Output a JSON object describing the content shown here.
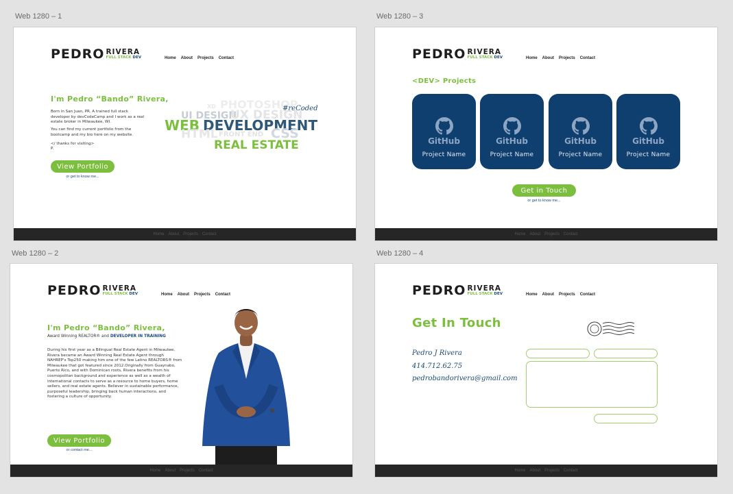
{
  "frames": {
    "f1": "Web 1280 – 1",
    "f2": "Web 1280 – 2",
    "f3": "Web 1280 – 3",
    "f4": "Web 1280 – 4"
  },
  "logo": {
    "main": "PEDRO",
    "side": "RIVERA",
    "tag_a": "FULL STACK",
    "tag_b": "DEV"
  },
  "nav": [
    "Home",
    "About",
    "Projects",
    "Contact"
  ],
  "footer": [
    "Home",
    "About",
    "Projects",
    "Contact"
  ],
  "home": {
    "heading": "I'm Pedro “Bando” Rivera,",
    "p1": "Born in San Juan, PR. A trained full stack developer by devCodeCamp and I work as a real estate broker in Milwaukee, WI.",
    "p2": "You can find my current portfolio from the bootcamp and my bio here on my website.",
    "p3": "</ thanks for visiting>",
    "p4": "P.",
    "button": "View Portfolio",
    "link": "or get to know me...",
    "cloud": {
      "xd": "XD",
      "photoshop": "PHOTOSHOP",
      "uidesign": "UI DESIGN",
      "uxdesign": "UX DESIGN",
      "recoded": "#reCoded",
      "web": "WEB",
      "development": "DEVELOPMENT",
      "html": "HTML",
      "frontend": "FRONT END",
      "css": "CSS",
      "realestate": "REAL ESTATE"
    }
  },
  "about": {
    "heading": "I'm Pedro “Bando” Rivera,",
    "sub_a": "Award Winning REALTOR® and ",
    "sub_b": "DEVELOPER IN TRAINING",
    "body": "During his first year as a Bilingual Real Estate Agent in Milwaukee, Rivera became an Award Winning Real Estate Agent through NAHREP's Top250 making him one of the few Latino REALTORS® from Milwaukee that got featured since 2012.Originally from Guaynabo, Puerto Rico, and with Dominican roots, Rivera benefits from his cosmopolitan background and experience as well as a wealth of international contacts to serve as a resource to home buyers, home sellers, and real estate agents. Believer in sustainable performance, purposeful leadership, bringing back human interactions, and fostering a culture of opportunity.",
    "button": "View Portfolio",
    "link": "or contact me..."
  },
  "projects": {
    "heading": "<DEV> Projects",
    "cards": [
      {
        "brand": "GitHub",
        "name": "Project Name"
      },
      {
        "brand": "GitHub",
        "name": "Project Name"
      },
      {
        "brand": "GitHub",
        "name": "Project Name"
      },
      {
        "brand": "GitHub",
        "name": "Project Name"
      }
    ],
    "button": "Get in Touch",
    "link": "or get to know me..."
  },
  "contact": {
    "heading": "Get In Touch",
    "name": "Pedro J Rivera",
    "phone": "414.712.62.75",
    "email": "pedrobandorivera@gmail.com"
  },
  "colors": {
    "green": "#7cbf3f",
    "navy": "#1b4a7a",
    "card": "#0e3f6f",
    "footer": "#262626"
  }
}
